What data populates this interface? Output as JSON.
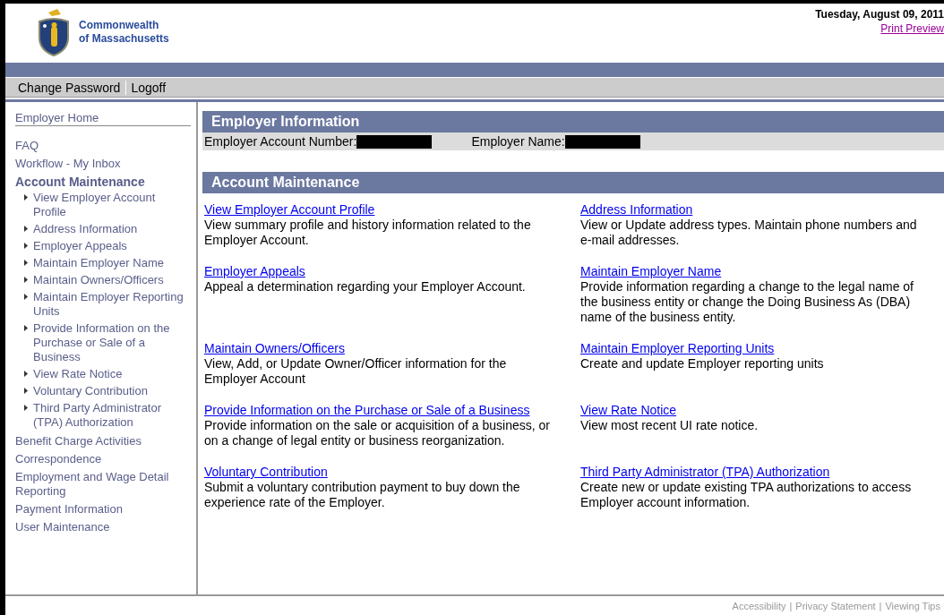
{
  "header": {
    "agency_name": [
      "Commonwealth",
      "of Massachusetts"
    ],
    "date": "Tuesday, August 09, 2011",
    "print_link": "Print Preview"
  },
  "top_nav": [
    "Change Password",
    "Logoff"
  ],
  "sidebar": {
    "items": [
      {
        "label": "Employer Home",
        "expanded": false
      },
      {
        "label": "FAQ",
        "expanded": false
      },
      {
        "label": "Workflow - My Inbox",
        "expanded": false
      },
      {
        "label": "Account Maintenance",
        "expanded": true,
        "children": [
          {
            "label": "View Employer Account Profile"
          },
          {
            "label": "Address Information"
          },
          {
            "label": "Employer Appeals"
          },
          {
            "label": "Maintain Employer Name"
          },
          {
            "label": "Maintain Owners/Officers"
          },
          {
            "label": "Maintain Employer Reporting Units"
          },
          {
            "label": "Provide Information on the Purchase or Sale of a Business"
          },
          {
            "label": "View Rate Notice"
          },
          {
            "label": "Voluntary Contribution"
          },
          {
            "label": "Third Party Administrator (TPA) Authorization"
          }
        ]
      },
      {
        "label": "Benefit Charge Activities",
        "expanded": false
      },
      {
        "label": "Correspondence",
        "expanded": false
      },
      {
        "label": "Employment and Wage Detail Reporting",
        "expanded": false
      },
      {
        "label": "Payment Information",
        "expanded": false
      },
      {
        "label": "User Maintenance",
        "expanded": false
      }
    ]
  },
  "employer_info": {
    "title": "Employer Information",
    "fields": [
      "Employer Account Number:",
      "Employer Name:"
    ]
  },
  "account_maintenance": {
    "title": "Account Maintenance",
    "entries": [
      {
        "link": "View Employer Account Profile",
        "description": "View summary profile and history information related to the Employer Account."
      },
      {
        "link": "Address Information",
        "description": "View or Update address types. Maintain phone numbers and e-mail addresses."
      },
      {
        "link": "Employer Appeals",
        "description": "Appeal a determination regarding your Employer Account."
      },
      {
        "link": "Maintain Employer Name",
        "description": "Provide information regarding a change to the legal name of the business entity or change the Doing Business As (DBA) name of the business entity."
      },
      {
        "link": "Maintain Owners/Officers",
        "description": "View, Add, or Update Owner/Officer information for the Employer Account"
      },
      {
        "link": "Maintain Employer Reporting Units",
        "description": "Create and update Employer reporting units"
      },
      {
        "link": "Provide Information on the Purchase or Sale of a Business",
        "description": "Provide information on the sale or acquisition of a business, or on a change of legal entity or business reorganization."
      },
      {
        "link": "View Rate Notice",
        "description": "View most recent UI rate notice."
      },
      {
        "link": "Voluntary Contribution",
        "description": "Submit a voluntary contribution payment to buy down the experience rate of the Employer."
      },
      {
        "link": "Third Party Administrator (TPA) Authorization",
        "description": "Create new or update existing TPA authorizations to access Employer account information."
      }
    ]
  },
  "footer": {
    "links": [
      "Accessibility",
      "Privacy Statement",
      "Viewing Tips"
    ],
    "separator": "|"
  }
}
